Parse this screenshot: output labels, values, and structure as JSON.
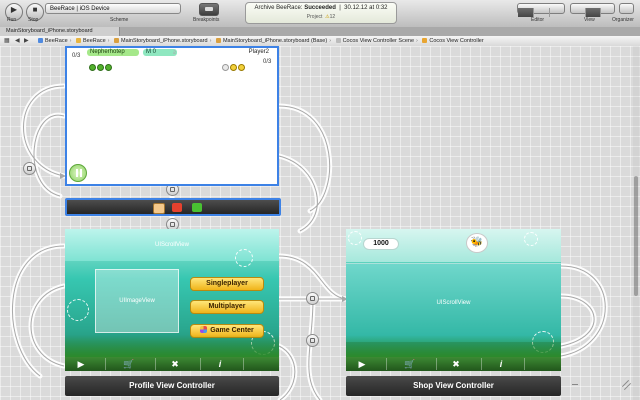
{
  "toolbar": {
    "run_label": "Run",
    "stop_label": "Stop",
    "scheme_text": "BeeRace  |  iOS Device",
    "scheme_caption": "Scheme",
    "breakpoints_caption": "Breakpoints",
    "activity_project": "Archive BeeRace:",
    "activity_status": "Succeeded",
    "activity_time": "30.12.12 at 0:32",
    "activity_line2_left": "Project",
    "activity_line2_count": "12",
    "editor_caption": "Editor",
    "view_caption": "View",
    "organizer_caption": "Organizer"
  },
  "tab": {
    "title": "MainStoryboard_iPhone.storyboard"
  },
  "jumpbar": {
    "crumbs": [
      "BeeRace",
      "BeeRace",
      "MainStoryboard_iPhone.storyboard",
      "MainStoryboard_iPhone.storyboard (Base)",
      "Cocos View Controller Scene",
      "Cocos View Controller"
    ]
  },
  "game": {
    "player1_name": "Nepherhotep",
    "player2_name": "Player2",
    "mode_text": "M   0",
    "counter1": "0/3",
    "counter2": "0/3",
    "colors": {
      "border": "#3d82e6",
      "player1_pill": "#a5e88a",
      "bee_green": "#52b02c",
      "bee_yellow": "#f2d03a"
    }
  },
  "profile": {
    "scroll_view_label": "UIScrollView",
    "image_view_label": "UIImageView",
    "buttons": [
      "Singleplayer",
      "Multiplayer",
      "Game Center"
    ],
    "title": "Profile View Controller",
    "tab_icons": [
      "play-icon",
      "cart-icon",
      "tools-icon",
      "info-icon"
    ]
  },
  "shop": {
    "coins": "1000",
    "scroll_view_label": "UIScrollView",
    "title": "Shop View Controller",
    "tab_icons": [
      "play-icon",
      "cart-icon",
      "tools-icon",
      "info-icon"
    ]
  }
}
